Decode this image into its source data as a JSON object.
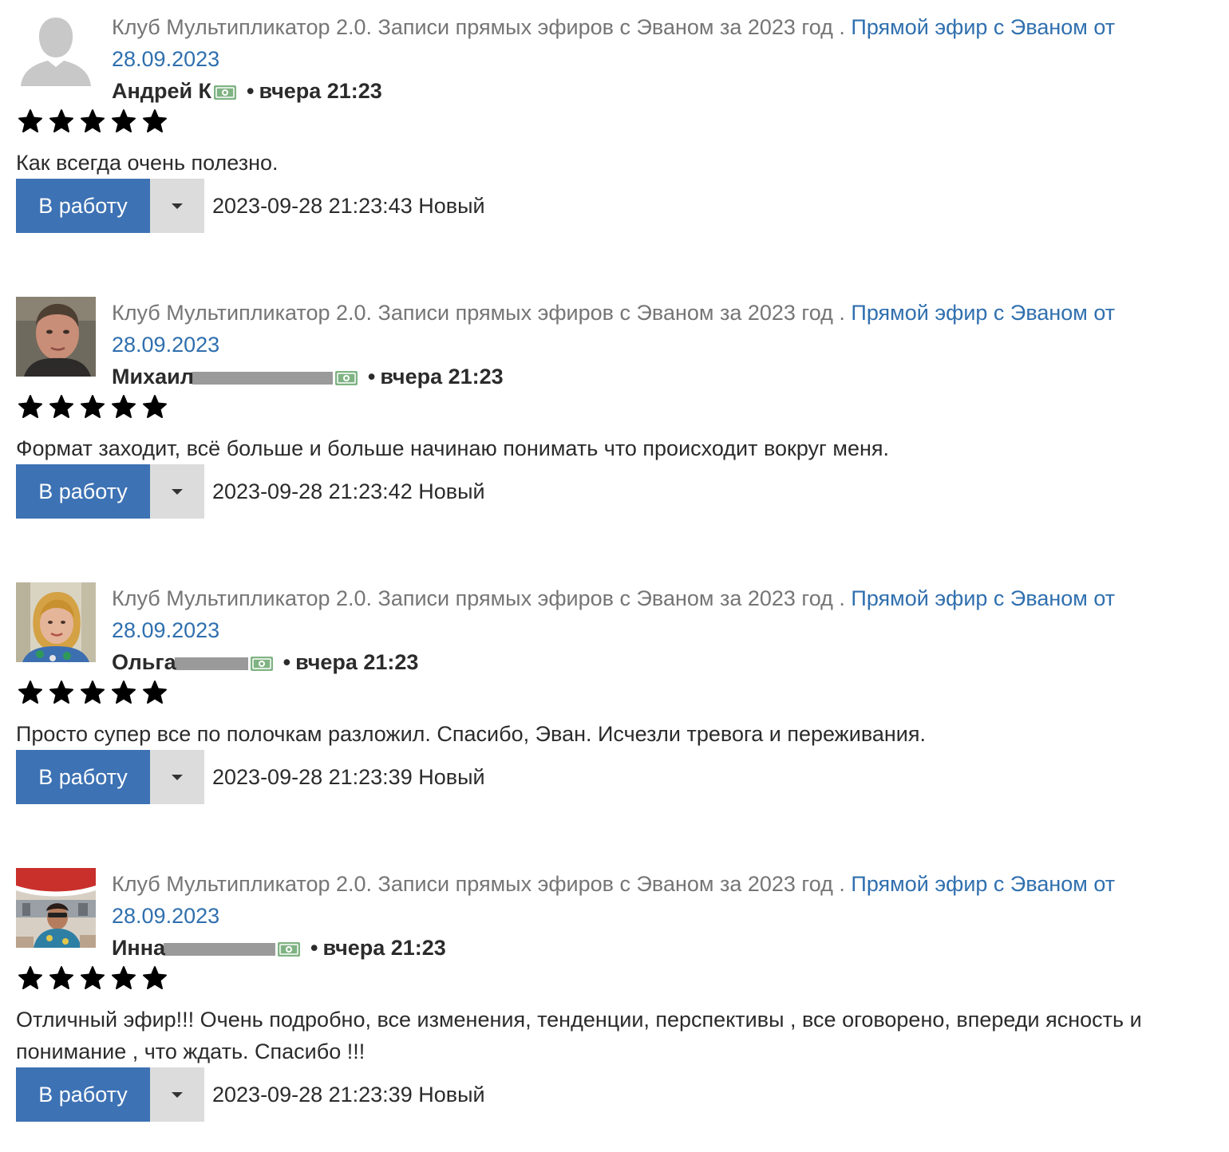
{
  "reviews": [
    {
      "course": "Клуб Мультипликатор 2.0. Записи прямых эфиров с Эваном за 2023 год",
      "separator": ".",
      "lesson": "Прямой эфир с Эваном от 28.09.2023",
      "author": "Андрей К",
      "bullet": "•",
      "time": "вчера 21:23",
      "rating": 5,
      "text": "Как всегда очень полезно.",
      "action_label": "В работу",
      "datetime": "2023-09-28 21:23:43",
      "status": "Новый",
      "avatar": "default-avatar"
    },
    {
      "course": "Клуб Мультипликатор 2.0. Записи прямых эфиров с Эваном за 2023 год",
      "separator": ".",
      "lesson": "Прямой эфир с Эваном от 28.09.2023",
      "author": "Михаил",
      "bullet": "•",
      "time": "вчера 21:23",
      "rating": 5,
      "text": "Формат заходит, всё больше и больше начинаю понимать что происходит вокруг меня.",
      "action_label": "В работу",
      "datetime": "2023-09-28 21:23:42",
      "status": "Новый",
      "avatar": "user-photo"
    },
    {
      "course": "Клуб Мультипликатор 2.0. Записи прямых эфиров с Эваном за 2023 год",
      "separator": ".",
      "lesson": "Прямой эфир с Эваном от 28.09.2023",
      "author": "Ольга",
      "bullet": "•",
      "time": "вчера 21:23",
      "rating": 5,
      "text": "Просто супер все по полочкам разложил. Спасибо, Эван. Исчезли тревога и переживания.",
      "action_label": "В работу",
      "datetime": "2023-09-28 21:23:39",
      "status": "Новый",
      "avatar": "user-photo"
    },
    {
      "course": "Клуб Мультипликатор 2.0. Записи прямых эфиров с Эваном за 2023 год",
      "separator": ".",
      "lesson": "Прямой эфир с Эваном от 28.09.2023",
      "author": "Инна",
      "bullet": "•",
      "time": "вчера 21:23",
      "rating": 5,
      "text": "Отличный эфир!!! Очень подробно, все изменения, тенденции, перспективы , все оговорено, впереди ясность и понимание , что ждать. Спасибо !!!",
      "action_label": "В работу",
      "datetime": "2023-09-28 21:23:39",
      "status": "Новый",
      "avatar": "user-photo"
    }
  ],
  "colors": {
    "link": "#2f6fae",
    "course_text": "#757575",
    "primary_button": "#3d72b4",
    "dropdown_button": "#dcdcdc",
    "money_icon": "#7fb383"
  },
  "icons": {
    "star": "star-icon",
    "money": "money-icon",
    "dropdown": "caret-down-icon",
    "avatar_default": "user-silhouette-icon"
  }
}
